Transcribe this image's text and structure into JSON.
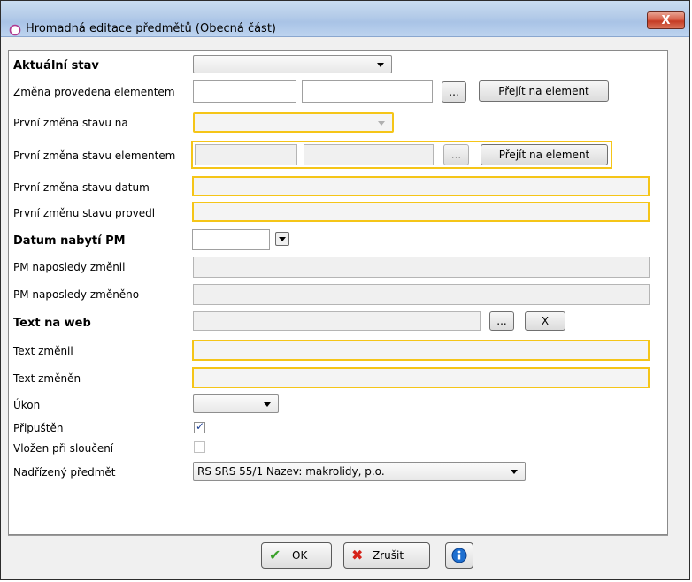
{
  "window": {
    "title": "Hromadná editace předmětů (Obecná část)",
    "close_label": "X"
  },
  "form": {
    "aktualni_stav": {
      "label": "Aktuální stav",
      "value": ""
    },
    "zmena_elementem": {
      "label": "Změna provedena elementem",
      "browse_label": "...",
      "goto_label": "Přejít na element"
    },
    "prvni_zmena_na": {
      "label": "První změna stavu na",
      "value": ""
    },
    "prvni_zmena_elementem": {
      "label": "První změna stavu elementem",
      "browse_label": "...",
      "goto_label": "Přejít na element"
    },
    "prvni_zmena_datum": {
      "label": "První změna stavu datum"
    },
    "prvni_zmena_provedl": {
      "label": "První změnu stavu provedl"
    },
    "datum_nabyti": {
      "label": "Datum nabytí PM",
      "value": ""
    },
    "pm_zmenil": {
      "label": "PM naposledy změnil"
    },
    "pm_zmeneno": {
      "label": "PM naposledy změněno"
    },
    "text_web": {
      "label": "Text na web",
      "browse_label": "...",
      "clear_label": "X"
    },
    "text_zmenil": {
      "label": "Text změnil"
    },
    "text_zmenen": {
      "label": "Text změněn"
    },
    "ukon": {
      "label": "Úkon",
      "value": ""
    },
    "pripusten": {
      "label": "Připuštěn",
      "checked": true
    },
    "vlozen": {
      "label": "Vložen při sloučení",
      "checked": false
    },
    "nadrizeny": {
      "label": "Nadřízený předmět",
      "value": "RS SRS 55/1 Nazev: makrolidy, p.o."
    }
  },
  "footer": {
    "ok_label": "OK",
    "cancel_label": "Zrušit"
  },
  "colors": {
    "highlight": "#f5c518",
    "titlebar": "#b6cde9",
    "close": "#c53b24"
  }
}
